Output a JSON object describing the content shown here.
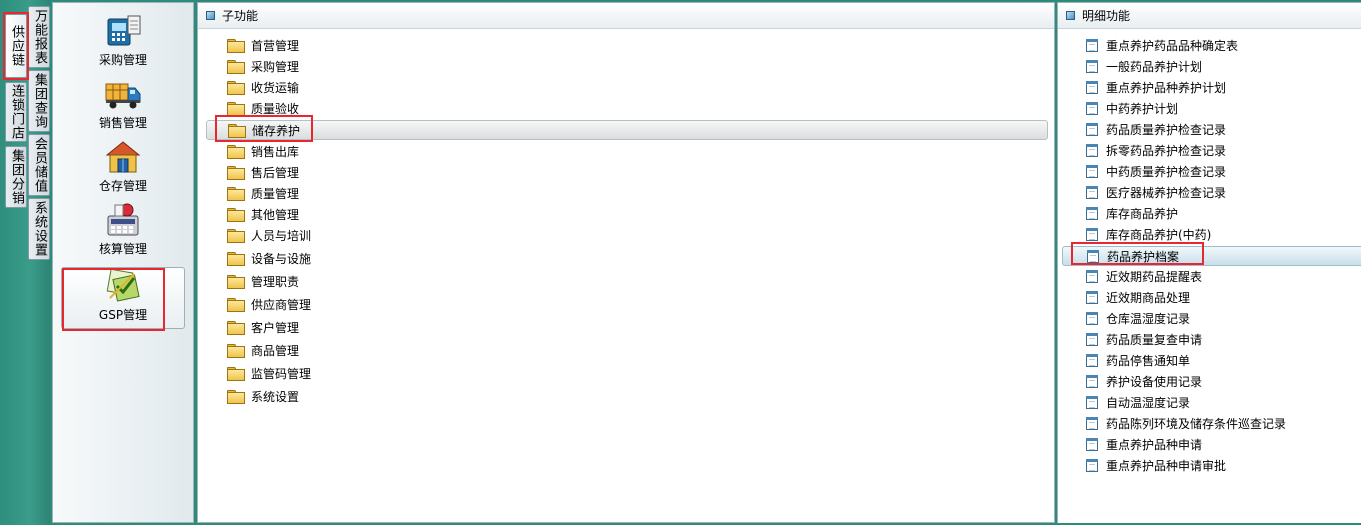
{
  "side_tabs": {
    "col1": [
      {
        "label": "供应链",
        "active": true
      },
      {
        "label": "连锁门店",
        "active": false
      },
      {
        "label": "集团分销",
        "active": false
      }
    ],
    "col2": [
      {
        "label": "万能报表"
      },
      {
        "label": "集团查询"
      },
      {
        "label": "会员储值"
      },
      {
        "label": "系统设置"
      }
    ]
  },
  "modules": [
    {
      "label": "采购管理",
      "icon": "purchase-icon"
    },
    {
      "label": "销售管理",
      "icon": "sales-truck-icon"
    },
    {
      "label": "仓存管理",
      "icon": "warehouse-icon"
    },
    {
      "label": "核算管理",
      "icon": "accounting-icon"
    },
    {
      "label": "GSP管理",
      "icon": "gsp-icon",
      "selected": true
    }
  ],
  "sub_panel": {
    "title": "子功能",
    "items": [
      {
        "label": "首营管理"
      },
      {
        "label": "采购管理"
      },
      {
        "label": "收货运输"
      },
      {
        "label": "质量验收"
      },
      {
        "label": "储存养护",
        "selected": true
      },
      {
        "label": "销售出库"
      },
      {
        "label": "售后管理"
      },
      {
        "label": "质量管理"
      },
      {
        "label": "其他管理"
      },
      {
        "label": "人员与培训"
      },
      {
        "label": "设备与设施"
      },
      {
        "label": "管理职责"
      },
      {
        "label": "供应商管理"
      },
      {
        "label": "客户管理"
      },
      {
        "label": "商品管理"
      },
      {
        "label": "监管码管理"
      },
      {
        "label": "系统设置"
      }
    ]
  },
  "detail_panel": {
    "title": "明细功能",
    "items": [
      {
        "label": "重点养护药品品种确定表"
      },
      {
        "label": "一般药品养护计划"
      },
      {
        "label": "重点养护品种养护计划"
      },
      {
        "label": "中药养护计划"
      },
      {
        "label": "药品质量养护检查记录"
      },
      {
        "label": "拆零药品养护检查记录"
      },
      {
        "label": "中药质量养护检查记录"
      },
      {
        "label": "医疗器械养护检查记录"
      },
      {
        "label": "库存商品养护"
      },
      {
        "label": "库存商品养护(中药)"
      },
      {
        "label": "药品养护档案",
        "selected": true
      },
      {
        "label": "近效期药品提醒表"
      },
      {
        "label": "近效期商品处理"
      },
      {
        "label": "仓库温湿度记录"
      },
      {
        "label": "药品质量复查申请"
      },
      {
        "label": "药品停售通知单"
      },
      {
        "label": "养护设备使用记录"
      },
      {
        "label": "自动温湿度记录"
      },
      {
        "label": "药品陈列环境及储存条件巡查记录"
      },
      {
        "label": "重点养护品种申请"
      },
      {
        "label": "重点养护品种申请审批"
      }
    ]
  },
  "colors": {
    "highlight_box": "#e8282e",
    "strip": "#2f8e7d"
  }
}
